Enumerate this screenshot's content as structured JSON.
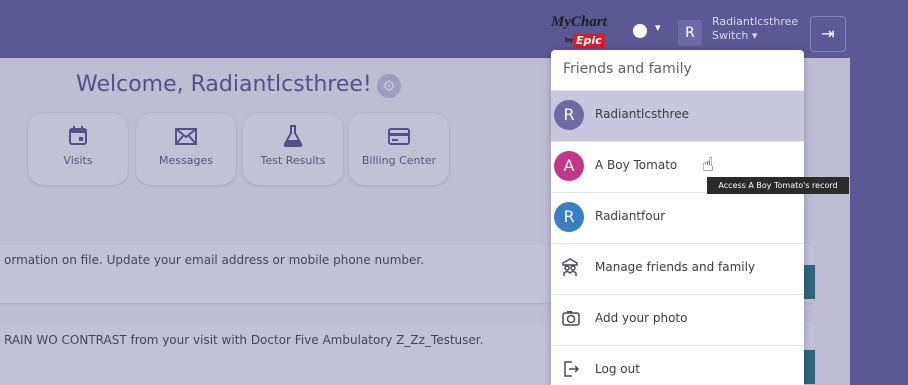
{
  "header": {
    "logo_mychart": "MyChart",
    "logo_by": "by",
    "logo_epic": "Epic",
    "globe_caret": "▾",
    "user_initial": "R",
    "user_name": "Radiantlcsthree",
    "switch_label": "Switch ▾"
  },
  "main": {
    "welcome": "Welcome, Radiantlcsthree!",
    "tiles": [
      {
        "label": "Visits",
        "icon": "calendar-icon"
      },
      {
        "label": "Messages",
        "icon": "envelope-icon"
      },
      {
        "label": "Test Results",
        "icon": "flask-icon"
      },
      {
        "label": "Billing Center",
        "icon": "credit-card-icon"
      }
    ],
    "cards": [
      {
        "text": "ormation on file. Update your email address or mobile phone number."
      },
      {
        "text": "RAIN WO CONTRAST from your visit with Doctor Five Ambulatory Z_Zz_Testuser."
      }
    ]
  },
  "menu": {
    "title": "Friends and family",
    "people": [
      {
        "initial": "R",
        "name": "Radiantlcsthree",
        "color": "#6e6ba4",
        "selected": true
      },
      {
        "initial": "A",
        "name": "A Boy Tomato",
        "color": "#c2378c",
        "selected": false
      },
      {
        "initial": "R",
        "name": "Radiantfour",
        "color": "#3a7fc2",
        "selected": false
      }
    ],
    "actions": [
      {
        "label": "Manage friends and family",
        "icon": "family-icon"
      },
      {
        "label": "Add your photo",
        "icon": "camera-icon"
      },
      {
        "label": "Log out",
        "icon": "logout-icon"
      }
    ]
  },
  "tooltip": "Access A Boy Tomato's record",
  "colors": {
    "header_bg": "#5b5894",
    "accent_teal": "#1c6a79",
    "selected_row": "#c9c7df"
  }
}
